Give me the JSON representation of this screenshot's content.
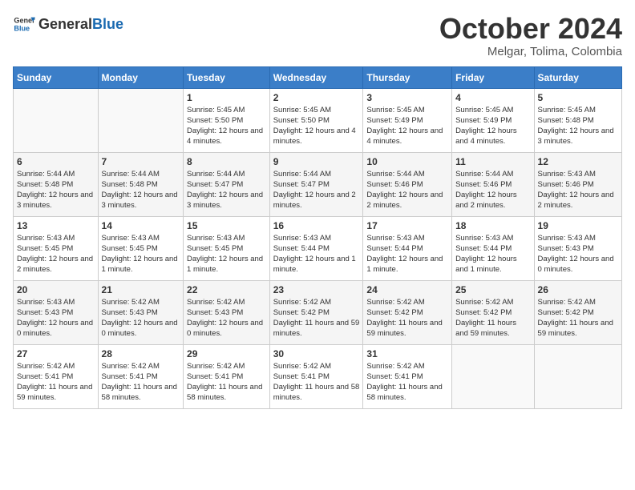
{
  "logo": {
    "general": "General",
    "blue": "Blue"
  },
  "title": "October 2024",
  "subtitle": "Melgar, Tolima, Colombia",
  "days_header": [
    "Sunday",
    "Monday",
    "Tuesday",
    "Wednesday",
    "Thursday",
    "Friday",
    "Saturday"
  ],
  "weeks": [
    [
      {
        "day": "",
        "info": ""
      },
      {
        "day": "",
        "info": ""
      },
      {
        "day": "1",
        "info": "Sunrise: 5:45 AM\nSunset: 5:50 PM\nDaylight: 12 hours and 4 minutes."
      },
      {
        "day": "2",
        "info": "Sunrise: 5:45 AM\nSunset: 5:50 PM\nDaylight: 12 hours and 4 minutes."
      },
      {
        "day": "3",
        "info": "Sunrise: 5:45 AM\nSunset: 5:49 PM\nDaylight: 12 hours and 4 minutes."
      },
      {
        "day": "4",
        "info": "Sunrise: 5:45 AM\nSunset: 5:49 PM\nDaylight: 12 hours and 4 minutes."
      },
      {
        "day": "5",
        "info": "Sunrise: 5:45 AM\nSunset: 5:48 PM\nDaylight: 12 hours and 3 minutes."
      }
    ],
    [
      {
        "day": "6",
        "info": "Sunrise: 5:44 AM\nSunset: 5:48 PM\nDaylight: 12 hours and 3 minutes."
      },
      {
        "day": "7",
        "info": "Sunrise: 5:44 AM\nSunset: 5:48 PM\nDaylight: 12 hours and 3 minutes."
      },
      {
        "day": "8",
        "info": "Sunrise: 5:44 AM\nSunset: 5:47 PM\nDaylight: 12 hours and 3 minutes."
      },
      {
        "day": "9",
        "info": "Sunrise: 5:44 AM\nSunset: 5:47 PM\nDaylight: 12 hours and 2 minutes."
      },
      {
        "day": "10",
        "info": "Sunrise: 5:44 AM\nSunset: 5:46 PM\nDaylight: 12 hours and 2 minutes."
      },
      {
        "day": "11",
        "info": "Sunrise: 5:44 AM\nSunset: 5:46 PM\nDaylight: 12 hours and 2 minutes."
      },
      {
        "day": "12",
        "info": "Sunrise: 5:43 AM\nSunset: 5:46 PM\nDaylight: 12 hours and 2 minutes."
      }
    ],
    [
      {
        "day": "13",
        "info": "Sunrise: 5:43 AM\nSunset: 5:45 PM\nDaylight: 12 hours and 2 minutes."
      },
      {
        "day": "14",
        "info": "Sunrise: 5:43 AM\nSunset: 5:45 PM\nDaylight: 12 hours and 1 minute."
      },
      {
        "day": "15",
        "info": "Sunrise: 5:43 AM\nSunset: 5:45 PM\nDaylight: 12 hours and 1 minute."
      },
      {
        "day": "16",
        "info": "Sunrise: 5:43 AM\nSunset: 5:44 PM\nDaylight: 12 hours and 1 minute."
      },
      {
        "day": "17",
        "info": "Sunrise: 5:43 AM\nSunset: 5:44 PM\nDaylight: 12 hours and 1 minute."
      },
      {
        "day": "18",
        "info": "Sunrise: 5:43 AM\nSunset: 5:44 PM\nDaylight: 12 hours and 1 minute."
      },
      {
        "day": "19",
        "info": "Sunrise: 5:43 AM\nSunset: 5:43 PM\nDaylight: 12 hours and 0 minutes."
      }
    ],
    [
      {
        "day": "20",
        "info": "Sunrise: 5:43 AM\nSunset: 5:43 PM\nDaylight: 12 hours and 0 minutes."
      },
      {
        "day": "21",
        "info": "Sunrise: 5:42 AM\nSunset: 5:43 PM\nDaylight: 12 hours and 0 minutes."
      },
      {
        "day": "22",
        "info": "Sunrise: 5:42 AM\nSunset: 5:43 PM\nDaylight: 12 hours and 0 minutes."
      },
      {
        "day": "23",
        "info": "Sunrise: 5:42 AM\nSunset: 5:42 PM\nDaylight: 11 hours and 59 minutes."
      },
      {
        "day": "24",
        "info": "Sunrise: 5:42 AM\nSunset: 5:42 PM\nDaylight: 11 hours and 59 minutes."
      },
      {
        "day": "25",
        "info": "Sunrise: 5:42 AM\nSunset: 5:42 PM\nDaylight: 11 hours and 59 minutes."
      },
      {
        "day": "26",
        "info": "Sunrise: 5:42 AM\nSunset: 5:42 PM\nDaylight: 11 hours and 59 minutes."
      }
    ],
    [
      {
        "day": "27",
        "info": "Sunrise: 5:42 AM\nSunset: 5:41 PM\nDaylight: 11 hours and 59 minutes."
      },
      {
        "day": "28",
        "info": "Sunrise: 5:42 AM\nSunset: 5:41 PM\nDaylight: 11 hours and 58 minutes."
      },
      {
        "day": "29",
        "info": "Sunrise: 5:42 AM\nSunset: 5:41 PM\nDaylight: 11 hours and 58 minutes."
      },
      {
        "day": "30",
        "info": "Sunrise: 5:42 AM\nSunset: 5:41 PM\nDaylight: 11 hours and 58 minutes."
      },
      {
        "day": "31",
        "info": "Sunrise: 5:42 AM\nSunset: 5:41 PM\nDaylight: 11 hours and 58 minutes."
      },
      {
        "day": "",
        "info": ""
      },
      {
        "day": "",
        "info": ""
      }
    ]
  ]
}
